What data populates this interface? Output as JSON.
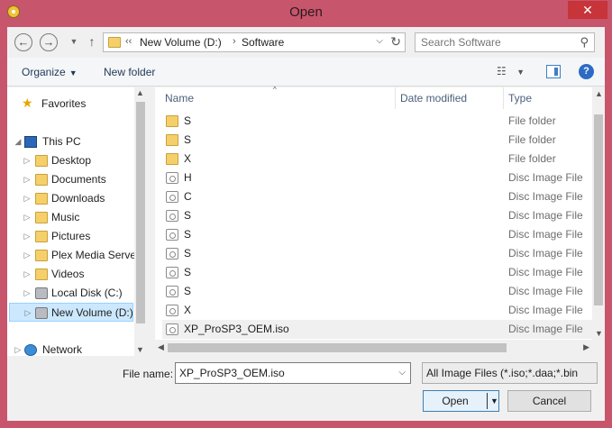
{
  "window": {
    "title": "Open",
    "close_symbol": "✕"
  },
  "nav": {
    "back_symbol": "←",
    "forward_symbol": "→",
    "up_symbol": "↑",
    "address_prefix": "‹‹",
    "address_crumbs": [
      "New Volume (D:)",
      "Software"
    ],
    "address_separator": "›",
    "refresh_symbol": "↻",
    "search_placeholder": "Search Software"
  },
  "toolbar": {
    "organize_label": "Organize",
    "new_folder_label": "New folder"
  },
  "sidebar": {
    "items": [
      {
        "label": "Favorites",
        "icon": "star-icon",
        "indent": 0,
        "expander": ""
      },
      {
        "label": "This PC",
        "icon": "computer-icon",
        "indent": 0,
        "expander": "◢"
      },
      {
        "label": "Desktop",
        "icon": "folder-icon",
        "indent": 1,
        "expander": "▷"
      },
      {
        "label": "Documents",
        "icon": "folder-icon",
        "indent": 1,
        "expander": "▷"
      },
      {
        "label": "Downloads",
        "icon": "folder-icon",
        "indent": 1,
        "expander": "▷"
      },
      {
        "label": "Music",
        "icon": "folder-icon",
        "indent": 1,
        "expander": "▷"
      },
      {
        "label": "Pictures",
        "icon": "folder-icon",
        "indent": 1,
        "expander": "▷"
      },
      {
        "label": "Plex Media Serve",
        "icon": "folder-icon",
        "indent": 1,
        "expander": "▷"
      },
      {
        "label": "Videos",
        "icon": "folder-icon",
        "indent": 1,
        "expander": "▷"
      },
      {
        "label": "Local Disk (C:)",
        "icon": "drive-icon",
        "indent": 1,
        "expander": "▷"
      },
      {
        "label": "New Volume (D:)",
        "icon": "drive-icon",
        "indent": 1,
        "expander": "▷",
        "selected": true
      },
      {
        "label": "Network",
        "icon": "network-icon",
        "indent": 0,
        "expander": "▷"
      }
    ]
  },
  "columns": {
    "name": "Name",
    "date_modified": "Date modified",
    "type": "Type"
  },
  "files": [
    {
      "name": "S",
      "date": "",
      "type": "File folder",
      "icon": "folder-icon"
    },
    {
      "name": "S",
      "date": "",
      "type": "File folder",
      "icon": "folder-icon"
    },
    {
      "name": "X",
      "date": "",
      "type": "File folder",
      "icon": "folder-icon"
    },
    {
      "name": "H",
      "date": "",
      "type": "Disc Image File",
      "icon": "disc-image-icon"
    },
    {
      "name": "C",
      "date": "",
      "type": "Disc Image File",
      "icon": "disc-image-icon"
    },
    {
      "name": "S",
      "date": "",
      "type": "Disc Image File",
      "icon": "disc-image-icon"
    },
    {
      "name": "S",
      "date": "",
      "type": "Disc Image File",
      "icon": "disc-image-icon"
    },
    {
      "name": "S",
      "date": "",
      "type": "Disc Image File",
      "icon": "disc-image-icon"
    },
    {
      "name": "S",
      "date": "",
      "type": "Disc Image File",
      "icon": "disc-image-icon"
    },
    {
      "name": "S",
      "date": "",
      "type": "Disc Image File",
      "icon": "disc-image-icon"
    },
    {
      "name": "X",
      "date": "",
      "type": "Disc Image File",
      "icon": "disc-image-icon"
    },
    {
      "name": "XP_ProSP3_OEM.iso",
      "date": "",
      "type": "Disc Image File",
      "icon": "disc-image-icon",
      "selected": true
    }
  ],
  "bottom": {
    "file_name_label": "File name:",
    "file_name_value": "XP_ProSP3_OEM.iso",
    "filter_value": "All Image Files (*.iso;*.daa;*.bin",
    "open_label": "Open",
    "cancel_label": "Cancel"
  }
}
